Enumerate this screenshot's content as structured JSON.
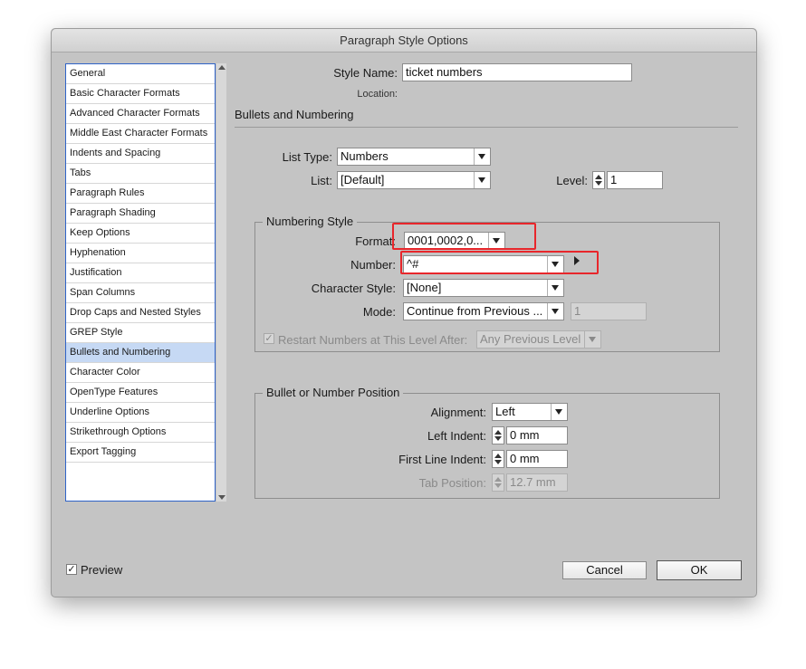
{
  "window": {
    "title": "Paragraph Style Options"
  },
  "sidebar": {
    "items": [
      {
        "label": "General"
      },
      {
        "label": "Basic Character Formats"
      },
      {
        "label": "Advanced Character Formats"
      },
      {
        "label": "Middle East Character Formats"
      },
      {
        "label": "Indents and Spacing"
      },
      {
        "label": "Tabs"
      },
      {
        "label": "Paragraph Rules"
      },
      {
        "label": "Paragraph Shading"
      },
      {
        "label": "Keep Options"
      },
      {
        "label": "Hyphenation"
      },
      {
        "label": "Justification"
      },
      {
        "label": "Span Columns"
      },
      {
        "label": "Drop Caps and Nested Styles"
      },
      {
        "label": "GREP Style"
      },
      {
        "label": "Bullets and Numbering",
        "selected": true
      },
      {
        "label": "Character Color"
      },
      {
        "label": "OpenType Features"
      },
      {
        "label": "Underline Options"
      },
      {
        "label": "Strikethrough Options"
      },
      {
        "label": "Export Tagging"
      }
    ]
  },
  "header": {
    "style_name_label": "Style Name:",
    "style_name_value": "ticket numbers",
    "location_label": "Location:",
    "section_title": "Bullets and Numbering"
  },
  "list": {
    "list_type_label": "List Type:",
    "list_type_value": "Numbers",
    "list_label": "List:",
    "list_value": "[Default]",
    "level_label": "Level:",
    "level_value": "1"
  },
  "numbering_style": {
    "title": "Numbering Style",
    "format_label": "Format:",
    "format_value": "0001,0002,0...",
    "number_label": "Number:",
    "number_value": "^#",
    "char_style_label": "Character Style:",
    "char_style_value": "[None]",
    "mode_label": "Mode:",
    "mode_value": "Continue from Previous ...",
    "mode_start_value": "1",
    "restart_label": "Restart Numbers at This Level After:",
    "restart_checked": true,
    "restart_value": "Any Previous Level"
  },
  "position": {
    "title": "Bullet or Number Position",
    "alignment_label": "Alignment:",
    "alignment_value": "Left",
    "left_indent_label": "Left Indent:",
    "left_indent_value": "0 mm",
    "first_line_label": "First Line Indent:",
    "first_line_value": "0 mm",
    "tab_position_label": "Tab Position:",
    "tab_position_value": "12.7 mm"
  },
  "footer": {
    "preview_label": "Preview",
    "preview_checked": true,
    "cancel_label": "Cancel",
    "ok_label": "OK"
  },
  "colors": {
    "dialog_bg": "#c4c4c4",
    "selection": "#c6d9f4",
    "sidebar_border": "#2f63c8",
    "highlight": "#e8262b"
  }
}
